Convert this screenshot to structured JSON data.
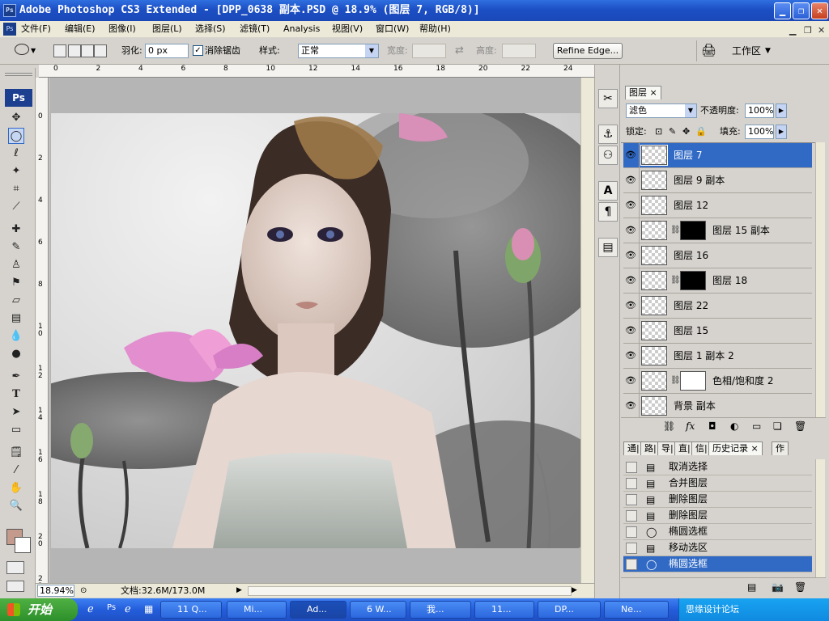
{
  "window": {
    "title": "Adobe Photoshop CS3 Extended - [DPP_0638 副本.PSD @ 18.9% (图层 7, RGB/8)]",
    "app_badge": "Ps"
  },
  "menu": [
    "文件(F)",
    "编辑(E)",
    "图像(I)",
    "图层(L)",
    "选择(S)",
    "滤镜(T)",
    "Analysis",
    "视图(V)",
    "窗口(W)",
    "帮助(H)"
  ],
  "options": {
    "feather_label": "羽化:",
    "feather_value": "0 px",
    "antialias_label": "消除锯齿",
    "style_label": "样式:",
    "style_value": "正常",
    "width_label": "宽度:",
    "height_label": "高度:",
    "refine_edge": "Refine Edge...",
    "workspace": "工作区"
  },
  "toolbox": {
    "logo": "Ps"
  },
  "status": {
    "zoom": "18.94%",
    "doc": "文档:32.6M/173.0M"
  },
  "rulers": {
    "top": [
      "0",
      "2",
      "4",
      "6",
      "8",
      "10",
      "12",
      "14",
      "16",
      "18",
      "20",
      "22",
      "24"
    ],
    "left": [
      "0",
      "2",
      "4",
      "6",
      "8",
      "1\n0",
      "1\n2",
      "1\n4",
      "1\n6",
      "1\n8",
      "2\n0",
      "2\n2",
      "2\n4"
    ]
  },
  "layers": {
    "tab": "图层",
    "blend_mode": "滤色",
    "opacity_label": "不透明度:",
    "opacity_value": "100%",
    "lock_label": "锁定:",
    "fill_label": "填充:",
    "fill_value": "100%",
    "rows": [
      {
        "name": "图层 7",
        "selected": true,
        "mask": false
      },
      {
        "name": "图层 9 副本",
        "selected": false,
        "mask": false
      },
      {
        "name": "图层 12",
        "selected": false,
        "mask": false
      },
      {
        "name": "图层 15 副本",
        "selected": false,
        "mask": true
      },
      {
        "name": "图层 16",
        "selected": false,
        "mask": false
      },
      {
        "name": "图层 18",
        "selected": false,
        "mask": true
      },
      {
        "name": "图层 22",
        "selected": false,
        "mask": false
      },
      {
        "name": "图层 15",
        "selected": false,
        "mask": false
      },
      {
        "name": "图层 1 副本 2",
        "selected": false,
        "mask": false
      },
      {
        "name": "色相/饱和度 2",
        "selected": false,
        "mask": true
      },
      {
        "name": "背景 副本",
        "selected": false,
        "mask": false
      }
    ]
  },
  "history": {
    "tabs": [
      "通道",
      "路径",
      "导航",
      "直方",
      "信息",
      "历史记录",
      "动作"
    ],
    "tabs_shown": [
      "通|",
      "路|",
      "导|",
      "直|",
      "信|",
      "历史记录 ×",
      "作"
    ],
    "rows": [
      {
        "name": "取消选择",
        "icon": "doc"
      },
      {
        "name": "合并图层",
        "icon": "doc"
      },
      {
        "name": "删除图层",
        "icon": "doc"
      },
      {
        "name": "删除图层",
        "icon": "doc"
      },
      {
        "name": "椭圆选框",
        "icon": "ellipse"
      },
      {
        "name": "移动选区",
        "icon": "doc"
      },
      {
        "name": "椭圆选框",
        "icon": "ellipse",
        "selected": true
      }
    ]
  },
  "taskbar": {
    "start": "开始",
    "tasks": [
      "11 Q...",
      "Mi...",
      "Ad...",
      "6 W...",
      "我...",
      "11...",
      "DP...",
      "Ne..."
    ],
    "tray": "思缘设计论坛 www.missyuan.com"
  }
}
